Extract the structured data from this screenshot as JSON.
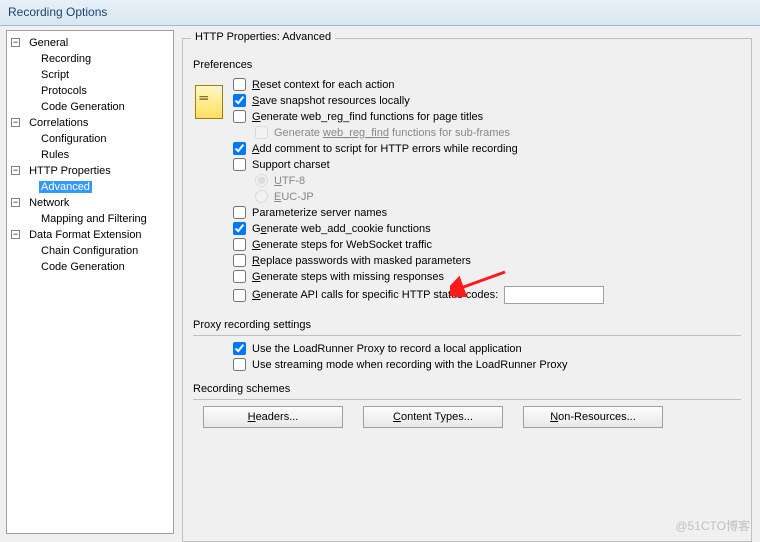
{
  "window": {
    "title": "Recording Options"
  },
  "tree": {
    "general": {
      "label": "General",
      "children": {
        "recording": "Recording",
        "script": "Script",
        "protocols": "Protocols",
        "codegen": "Code Generation"
      }
    },
    "correlations": {
      "label": "Correlations",
      "children": {
        "config": "Configuration",
        "rules": "Rules"
      }
    },
    "http": {
      "label": "HTTP Properties",
      "children": {
        "advanced": "Advanced"
      }
    },
    "network": {
      "label": "Network",
      "children": {
        "mapping": "Mapping and Filtering"
      }
    },
    "dfe": {
      "label": "Data Format Extension",
      "children": {
        "chain": "Chain Configuration",
        "codegen": "Code Generation"
      }
    }
  },
  "panel": {
    "title": "HTTP Properties: Advanced",
    "preferences_label": "Preferences",
    "options": {
      "reset": {
        "label": "Reset context for each action",
        "checked": false,
        "u": "R"
      },
      "snapshot": {
        "label": "Save snapshot resources locally",
        "checked": true,
        "u": "S"
      },
      "webregfind": {
        "label": "Generate web_reg_find functions for page titles",
        "checked": false,
        "u": "G"
      },
      "webregfind_sub": {
        "label": "Generate web_reg_find functions for sub-frames",
        "checked": false,
        "disabled": true,
        "u_word": "web_reg_find"
      },
      "addcomment": {
        "label": "Add comment to script for HTTP errors while recording",
        "checked": true,
        "u": "A"
      },
      "charset": {
        "label": "Support charset",
        "checked": false
      },
      "charset_utf8": {
        "label": "UTF-8",
        "disabled": true,
        "u": "U"
      },
      "charset_eucjp": {
        "label": "EUC-JP",
        "disabled": true,
        "u": "E"
      },
      "param_server": {
        "label": "Parameterize server names",
        "checked": false
      },
      "web_add_cookie": {
        "label": "Generate web_add_cookie functions",
        "checked": true,
        "u": "e"
      },
      "websocket": {
        "label": "Generate steps for WebSocket traffic",
        "checked": false,
        "u": "G"
      },
      "replace_pw": {
        "label": "Replace passwords with masked parameters",
        "checked": false,
        "u": "R"
      },
      "missing_resp": {
        "label": "Generate steps with missing responses",
        "checked": false,
        "u": "G"
      },
      "api_status": {
        "label": "Generate API calls for specific HTTP status codes:",
        "checked": false,
        "u": "G"
      }
    },
    "proxy": {
      "title": "Proxy recording settings",
      "use_proxy": {
        "label": "Use the LoadRunner Proxy to record a local application",
        "checked": true
      },
      "streaming": {
        "label": "Use streaming mode when recording with the LoadRunner Proxy",
        "checked": false
      }
    },
    "schemes": {
      "title": "Recording schemes",
      "headers_btn": "Headers...",
      "content_btn": "Content Types...",
      "nonres_btn": "Non-Resources..."
    }
  },
  "watermark": "@51CTO博客"
}
